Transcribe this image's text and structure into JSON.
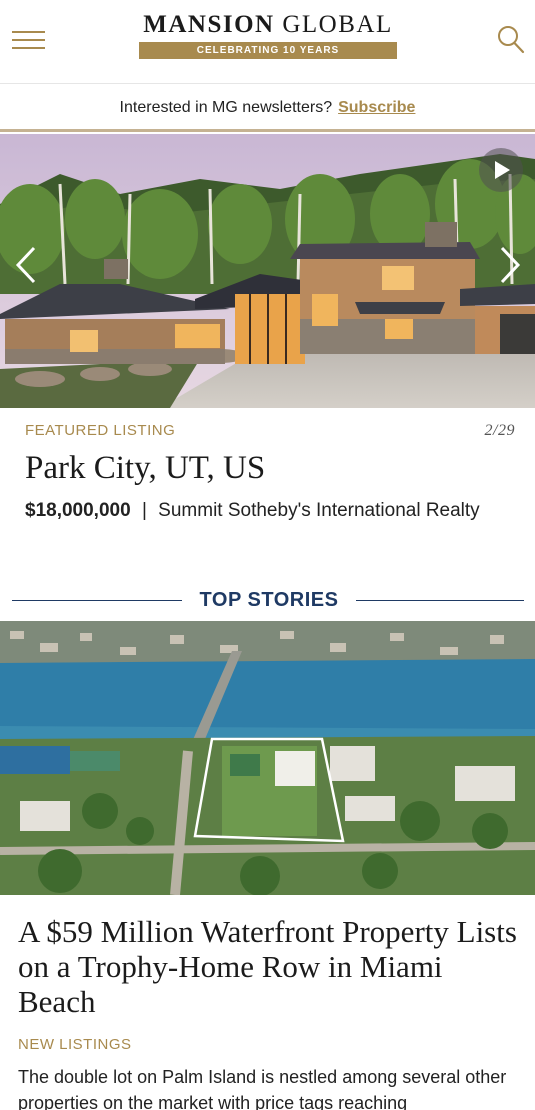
{
  "header": {
    "logo_bold": "MANSION",
    "logo_thin": "GLOBAL",
    "logo_tagline": "CELEBRATING 10 YEARS",
    "icons": {
      "menu": "hamburger-menu-icon",
      "search": "search-icon"
    }
  },
  "newsletter": {
    "prompt": "Interested in MG newsletters?",
    "link": "Subscribe"
  },
  "featured": {
    "label": "FEATURED LISTING",
    "counter": "2/29",
    "title": "Park City, UT, US",
    "price": "$18,000,000",
    "separator": "|",
    "agency": "Summit Sotheby's International Realty"
  },
  "top_stories": {
    "heading": "TOP STORIES",
    "story": {
      "title": "A $59 Million Waterfront Property Lists on a Trophy-Home Row in Miami Beach",
      "category": "NEW LISTINGS",
      "description": "The double lot on Palm Island is nestled among several other properties  on the market with price tags reaching"
    }
  },
  "colors": {
    "gold": "#a88a4e",
    "navy": "#1f3a64",
    "text": "#222222"
  }
}
